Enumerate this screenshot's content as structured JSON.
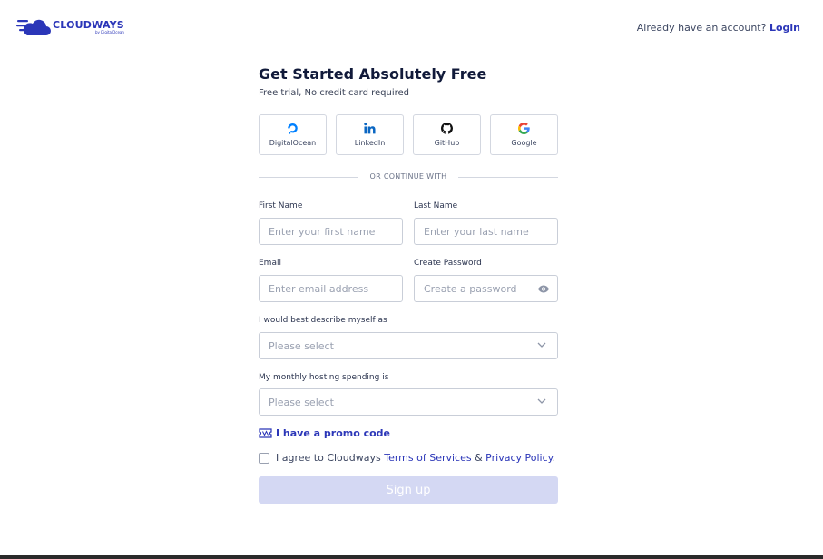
{
  "header": {
    "logo_brand": "CLOUDWAYS",
    "logo_sub": "by DigitalOcean",
    "account_prompt": "Already have an account?",
    "login_link": "Login"
  },
  "form": {
    "title": "Get Started Absolutely Free",
    "subtitle": "Free trial, No credit card required",
    "social": [
      {
        "label": "DigitalOcean",
        "icon": "digitalocean-icon"
      },
      {
        "label": "LinkedIn",
        "icon": "linkedin-icon"
      },
      {
        "label": "GitHub",
        "icon": "github-icon"
      },
      {
        "label": "Google",
        "icon": "google-icon"
      }
    ],
    "divider_text": "OR CONTINUE WITH",
    "first_name": {
      "label": "First Name",
      "placeholder": "Enter your first name",
      "value": ""
    },
    "last_name": {
      "label": "Last Name",
      "placeholder": "Enter your last name",
      "value": ""
    },
    "email": {
      "label": "Email",
      "placeholder": "Enter email address",
      "value": ""
    },
    "password": {
      "label": "Create Password",
      "placeholder": "Create a password",
      "value": ""
    },
    "describe": {
      "label": "I would best describe myself as",
      "selected": "Please select"
    },
    "spending": {
      "label": "My monthly hosting spending is",
      "selected": "Please select"
    },
    "promo_text": "I have a promo code",
    "agree": {
      "prefix": "I agree to Cloudways",
      "terms": "Terms of Services",
      "amp": "&",
      "privacy": "Privacy Policy",
      "suffix": "."
    },
    "signup_label": "Sign up"
  },
  "colors": {
    "brand": "#2b36b8",
    "signup_disabled": "#d4d8f3",
    "border": "#d3d7e0"
  }
}
